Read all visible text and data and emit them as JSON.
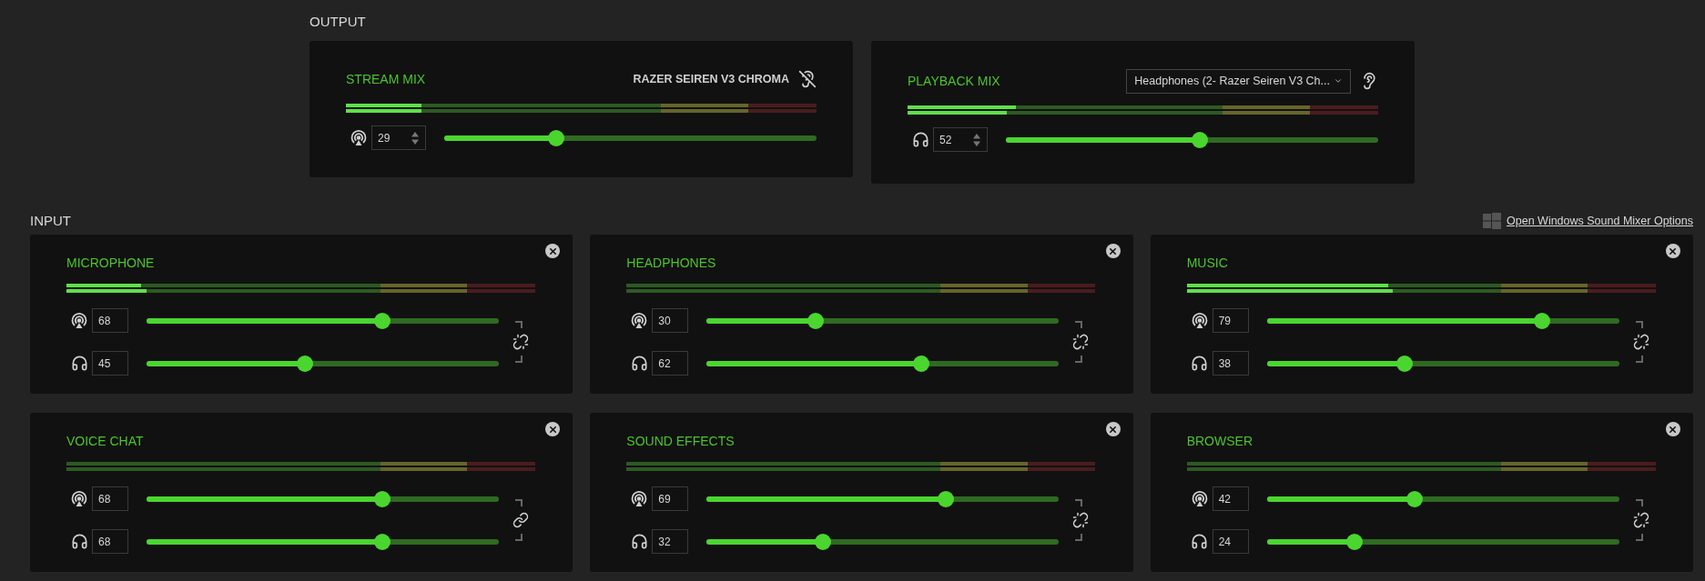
{
  "output": {
    "label": "OUTPUT",
    "mixes": [
      {
        "kind": "stream",
        "title": "STREAM MIX",
        "device": "RAZER SEIREN V3 CHROMA",
        "monitoring": false,
        "meters": [
          {
            "level": 0.16
          },
          {
            "level": 0.16
          }
        ],
        "channel": {
          "kind": "stream",
          "value": "29",
          "level": 0.3
        }
      },
      {
        "kind": "playback",
        "title": "PLAYBACK MIX",
        "dropdown": "Headphones (2- Razer Seiren V3 Ch...",
        "monitoring": true,
        "meters": [
          {
            "level": 0.23
          },
          {
            "level": 0.21
          }
        ],
        "channel": {
          "kind": "headphones",
          "value": "52",
          "level": 0.52
        }
      }
    ]
  },
  "input": {
    "label": "INPUT",
    "link": "Open Windows Sound Mixer Options",
    "sources": [
      {
        "title": "MICROPHONE",
        "linked": false,
        "meters": [
          {
            "level": 0.16
          },
          {
            "level": 0.17
          }
        ],
        "channels": [
          {
            "kind": "stream",
            "value": "68",
            "level": 0.67
          },
          {
            "kind": "headphones",
            "value": "45",
            "level": 0.45
          }
        ]
      },
      {
        "title": "HEADPHONES",
        "linked": false,
        "channels": [
          {
            "kind": "stream",
            "value": "30",
            "level": 0.31
          },
          {
            "kind": "headphones",
            "value": "62",
            "level": 0.61
          }
        ]
      },
      {
        "title": "MUSIC",
        "linked": false,
        "meters": [
          {
            "level": 0.43
          },
          {
            "level": 0.44
          }
        ],
        "channels": [
          {
            "kind": "stream",
            "value": "79",
            "level": 0.78
          },
          {
            "kind": "headphones",
            "value": "38",
            "level": 0.39
          }
        ]
      },
      {
        "title": "VOICE CHAT",
        "linked": true,
        "channels": [
          {
            "kind": "stream",
            "value": "68",
            "level": 0.67
          },
          {
            "kind": "headphones",
            "value": "68",
            "level": 0.67
          }
        ]
      },
      {
        "title": "SOUND EFFECTS",
        "linked": false,
        "channels": [
          {
            "kind": "stream",
            "value": "69",
            "level": 0.68
          },
          {
            "kind": "headphones",
            "value": "32",
            "level": 0.33
          }
        ]
      },
      {
        "title": "BROWSER",
        "linked": false,
        "channels": [
          {
            "kind": "stream",
            "value": "42",
            "level": 0.42
          },
          {
            "kind": "headphones",
            "value": "24",
            "level": 0.25
          }
        ]
      }
    ]
  }
}
